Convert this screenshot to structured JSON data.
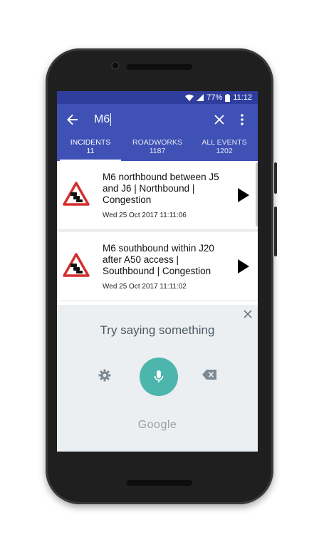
{
  "status_bar": {
    "battery": "77%",
    "time": "11:12",
    "icons": [
      "wifi-icon",
      "signal-icon",
      "battery-icon"
    ]
  },
  "search": {
    "query": "M6",
    "back_icon": "arrow-back-icon",
    "clear_icon": "close-icon",
    "menu_icon": "more-vert-icon"
  },
  "tabs": [
    {
      "label": "INCIDENTS",
      "count": "11",
      "active": true
    },
    {
      "label": "ROADWORKS",
      "count": "1187",
      "active": false
    },
    {
      "label": "ALL EVENTS",
      "count": "1202",
      "active": false
    }
  ],
  "incidents": [
    {
      "title": "M6 northbound between J5 and J6 | Northbound | Congestion",
      "time": "Wed 25 Oct 2017 11:11:06"
    },
    {
      "title": "M6 southbound within J20 after A50 access | Southbound | Congestion",
      "time": "Wed 25 Oct 2017 11:11:02"
    }
  ],
  "voice": {
    "prompt": "Try saying something",
    "brand": "Google"
  },
  "colors": {
    "appbar": "#3f51b5",
    "statusbar": "#2f3e9e",
    "mic": "#4db6ac",
    "warning_red": "#d32f2f"
  }
}
